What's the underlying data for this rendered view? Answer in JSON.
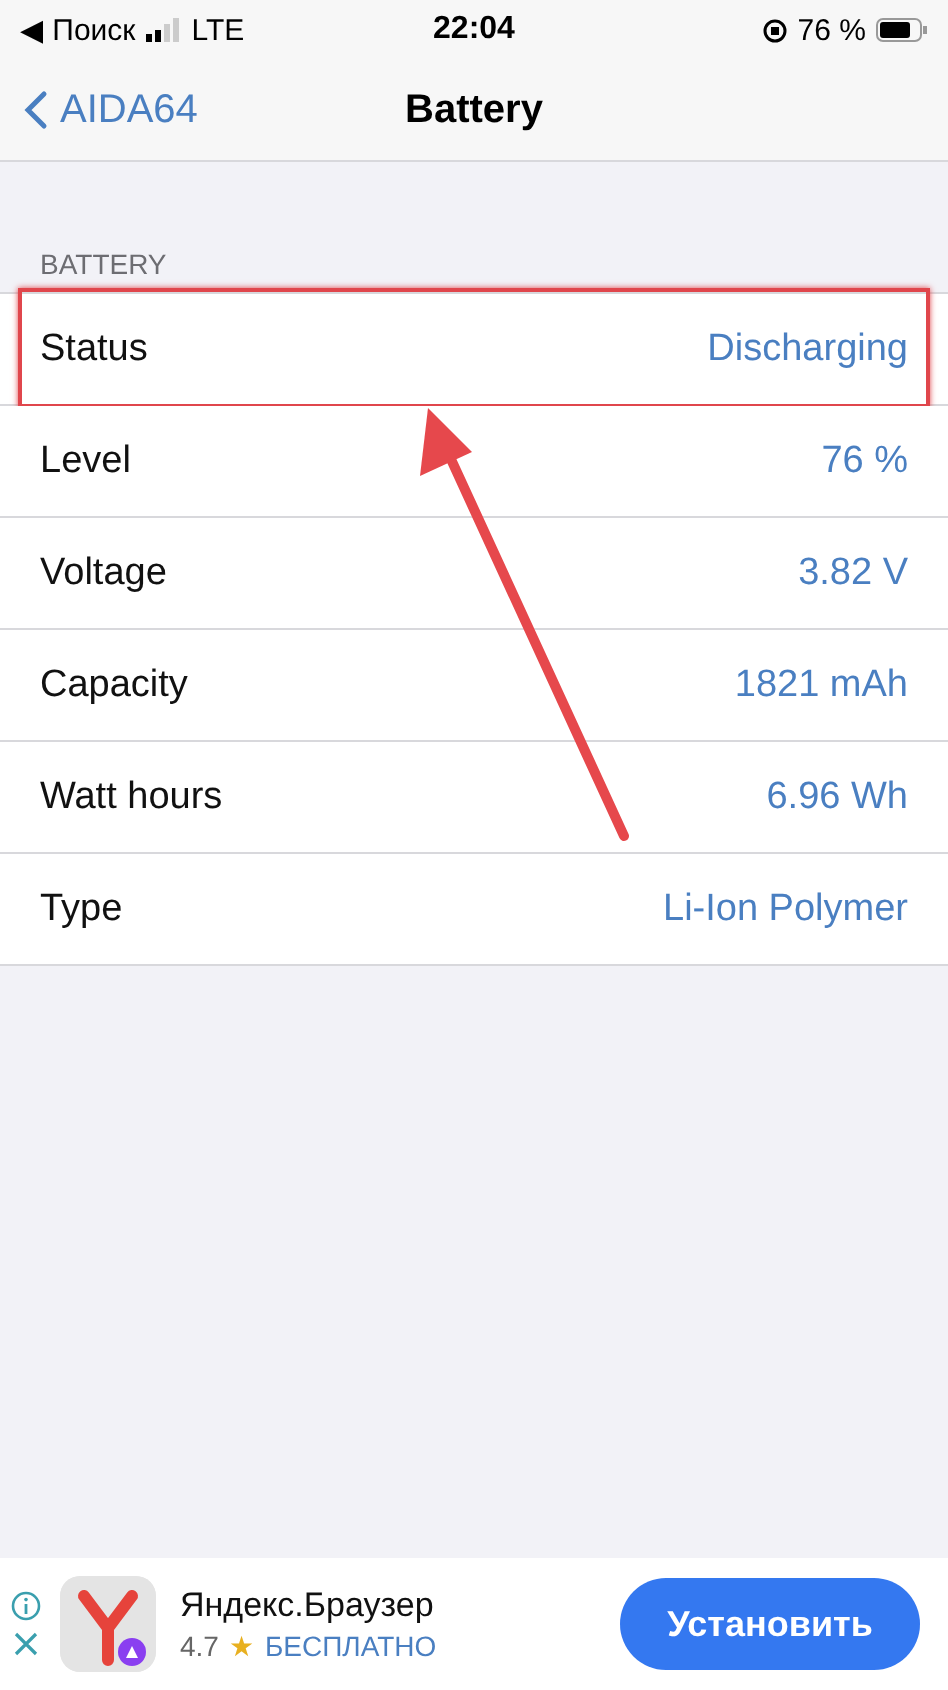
{
  "status_bar": {
    "back_label": "◀ Поиск",
    "network": "LTE",
    "time": "22:04",
    "battery_percent": "76 %"
  },
  "nav": {
    "back": "AIDA64",
    "title": "Battery"
  },
  "section": {
    "header": "BATTERY",
    "rows": [
      {
        "label": "Status",
        "value": "Discharging",
        "highlighted": true
      },
      {
        "label": "Level",
        "value": "76 %",
        "highlighted": false
      },
      {
        "label": "Voltage",
        "value": "3.82 V",
        "highlighted": false
      },
      {
        "label": "Capacity",
        "value": "1821 mAh",
        "highlighted": false
      },
      {
        "label": "Watt hours",
        "value": "6.96 Wh",
        "highlighted": false
      },
      {
        "label": "Type",
        "value": "Li-Ion Polymer",
        "highlighted": false
      }
    ]
  },
  "ad": {
    "app_name": "Яндекс.Браузер",
    "rating": "4.7",
    "star": "★",
    "price": "БЕСПЛАТНО",
    "button": "Установить"
  }
}
